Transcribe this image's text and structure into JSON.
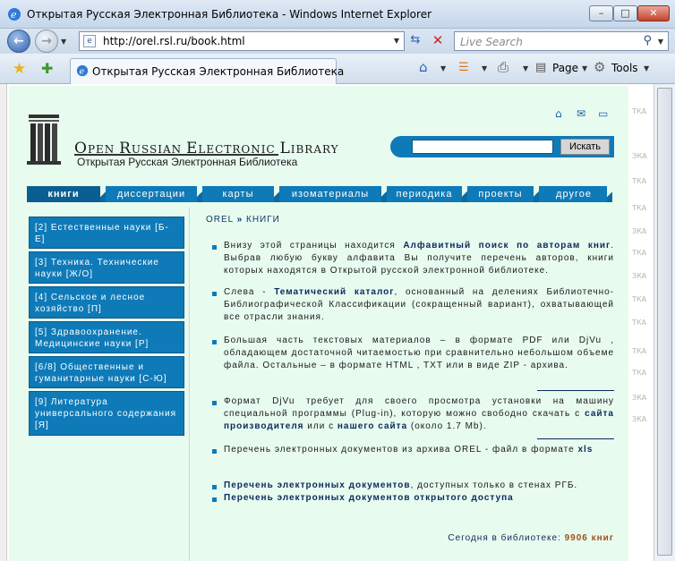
{
  "window": {
    "title": "Открытая Русская Электронная Библиотека - Windows Internet Explorer",
    "min_glyph": "–",
    "max_glyph": "□",
    "close_glyph": "✕"
  },
  "addressbar": {
    "url": "http://orel.rsl.ru/book.html",
    "search_placeholder": "Live Search"
  },
  "tabbar": {
    "tab_title": "Открытая Русская Электронная Библиотека",
    "page_label": "Page",
    "tools_label": "Tools"
  },
  "site": {
    "logo_en_parts": [
      "O",
      "PEN ",
      "R",
      "USSIAN ",
      "E",
      "LECTRONIC ",
      "L",
      "IBRARY"
    ],
    "logo_ru": "Открытая Русская Электронная Библиотека",
    "search_button": "Искать",
    "menu": [
      {
        "label": "книги",
        "active": true
      },
      {
        "label": "диссертации",
        "active": false
      },
      {
        "label": "карты",
        "active": false
      },
      {
        "label": "изоматериалы",
        "active": false
      },
      {
        "label": "периодика",
        "active": false
      },
      {
        "label": "проекты",
        "active": false
      },
      {
        "label": "другое",
        "active": false
      }
    ],
    "categories": [
      "[2] Естественные науки [Б-Е]",
      "[3] Техника. Технические науки [Ж/О]",
      "[4] Сельское и лесное хозяйство [П]",
      "[5] Здравоохранение. Медицинские науки [Р]",
      "[6/8] Общественные и гуманитарные науки [С-Ю]",
      "[9] Литература универсального содержания [Я]"
    ],
    "breadcrumb": {
      "root": "OREL",
      "sep": "»",
      "current": "КНИГИ"
    },
    "para1_a": "Внизу этой страницы находится ",
    "para1_b": "Алфавитный поиск по авторам книг",
    "para1_c": ". Выбрав любую букву алфавита Вы получите перечень авторов, книги которых находятся в Открытой русской электронной библиотеке.",
    "para2_a": "Слева - ",
    "para2_b": "Тематический каталог",
    "para2_c": ", основанный на делениях Библиотечно-Библиографической Классификации (сокращенный вариант), охватывающей все отрасли знания.",
    "para3": "Большая часть текстовых материалов – в формате PDF или DjVu , обладающем достаточной читаемостью при сравнительно небольшом объеме файла. Остальные – в формате HTML , TXT или в виде ZIP - архива.",
    "para4_a": "Формат DjVu требует для своего просмотра установки на машину специальной программы (Plug-in), которую можно свободно скачать с ",
    "para4_b": "сайта производителя",
    "para4_c": " или с ",
    "para4_d": "нашего сайта",
    "para4_e": " (около 1.7 Mb).",
    "para5_a": "Перечень электронных документов из архива OREL - файл в формате ",
    "para5_b": "xls",
    "link1_a": "Перечень электронных документов",
    "link1_b": ", доступных только в стенах РГБ.",
    "link2": "Перечень электронных документов открытого доступа",
    "footer_label": "Сегодня в библиотеке: ",
    "footer_count": "9906 книг"
  },
  "ghost_fragments": [
    "ТКА",
    "ЭКА",
    "ТКА",
    "ТКА",
    "ЗКА",
    "ТКА",
    "ЗКА",
    "ТКА",
    "ТКА",
    "ТКА",
    "ТКА",
    "ЗКА",
    "ЗКА"
  ]
}
